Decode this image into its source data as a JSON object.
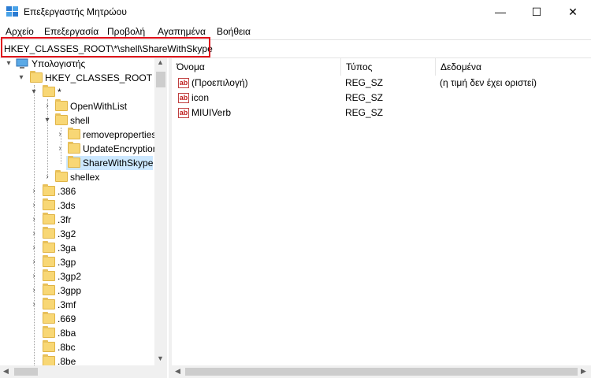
{
  "window": {
    "title": "Επεξεργαστής Μητρώου",
    "minimize_glyph": "—",
    "maximize_glyph": "☐",
    "close_glyph": "✕"
  },
  "menu": [
    "Αρχείο",
    "Επεξεργασία",
    "Προβολή",
    "Αγαπημένα",
    "Βοήθεια"
  ],
  "address": {
    "path": "HKEY_CLASSES_ROOT\\*\\shell\\ShareWithSkype"
  },
  "tree": {
    "root": "Υπολογιστής",
    "hive": "HKEY_CLASSES_ROOT",
    "star": "*",
    "openwithlist": "OpenWithList",
    "shell": "shell",
    "removeproperties": "removeproperties",
    "updateencryption": "UpdateEncryption",
    "sharewithskype": "ShareWithSkype",
    "shellex": "shellex",
    "extensions": [
      ".386",
      ".3ds",
      ".3fr",
      ".3g2",
      ".3ga",
      ".3gp",
      ".3gp2",
      ".3gpp",
      ".3mf",
      ".669",
      ".8ba",
      ".8bc",
      ".8be"
    ]
  },
  "list": {
    "columns": [
      "Όνομα",
      "Τύπος",
      "Δεδομένα"
    ],
    "rows": [
      {
        "name": "(Προεπιλογή)",
        "type": "REG_SZ",
        "data": "(η τιμή δεν έχει οριστεί)"
      },
      {
        "name": "icon",
        "type": "REG_SZ",
        "data": ""
      },
      {
        "name": "MIUIVerb",
        "type": "REG_SZ",
        "data": ""
      }
    ],
    "value_icon": "ab"
  },
  "colors": {
    "highlight": "#e0101a",
    "selection": "#cce8ff",
    "folder": "#f8d775"
  }
}
